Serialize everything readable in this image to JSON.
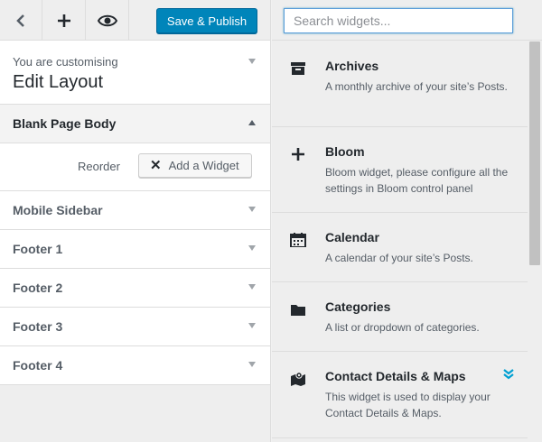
{
  "toolbar": {
    "back_icon": "chevron-left-icon",
    "add_icon": "plus-icon",
    "preview_icon": "eye-icon",
    "save_label": "Save & Publish"
  },
  "customizing": {
    "label": "You are customising",
    "title": "Edit Layout"
  },
  "sections": {
    "open": "Blank Page Body",
    "reorder_label": "Reorder",
    "add_widget_label": "Add a Widget",
    "items": [
      "Mobile Sidebar",
      "Footer 1",
      "Footer 2",
      "Footer 3",
      "Footer 4"
    ]
  },
  "search": {
    "placeholder": "Search widgets..."
  },
  "widgets": [
    {
      "title": "Archives",
      "desc": "A monthly archive of your site’s Posts.",
      "icon": "archive-icon"
    },
    {
      "title": "Bloom",
      "desc": "Bloom widget, please configure all the settings in Bloom control panel",
      "icon": "plus-icon"
    },
    {
      "title": "Calendar",
      "desc": "A calendar of your site’s Posts.",
      "icon": "calendar-icon"
    },
    {
      "title": "Categories",
      "desc": "A list or dropdown of categories.",
      "icon": "folder-icon"
    },
    {
      "title": "Contact Details & Maps",
      "desc": "This widget is used to display your Contact Details & Maps.",
      "icon": "map-icon"
    }
  ],
  "colors": {
    "primary": "#0085ba",
    "badge": "#00a0d2"
  }
}
